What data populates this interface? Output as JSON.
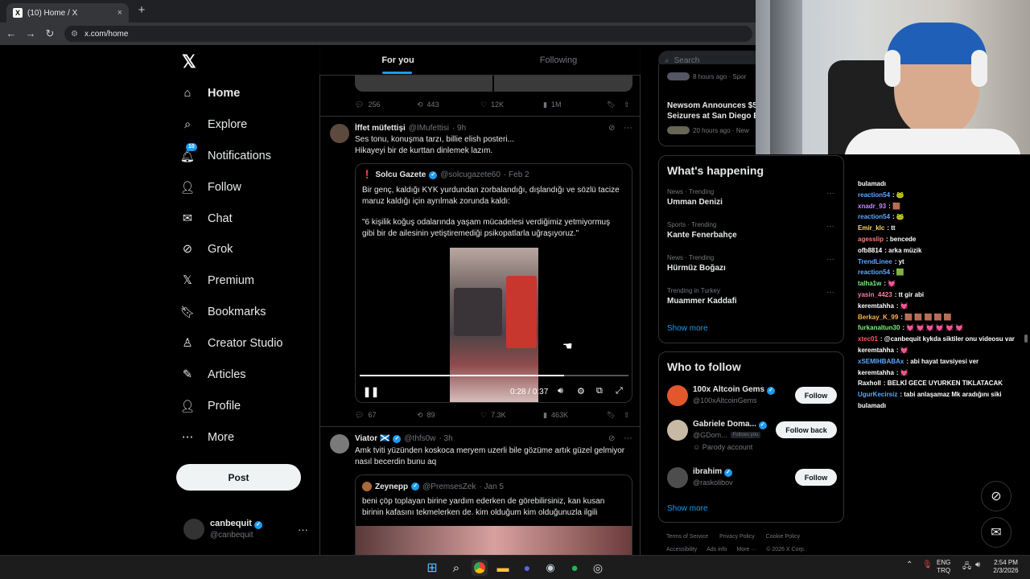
{
  "browser": {
    "tab_title": "(10) Home / X",
    "tab_close": "×",
    "new_tab": "+",
    "url": "x.com/home"
  },
  "nav": {
    "items": [
      {
        "label": "Home",
        "icon": "home-icon"
      },
      {
        "label": "Explore",
        "icon": "search-icon"
      },
      {
        "label": "Notifications",
        "icon": "bell-icon",
        "badge": "10"
      },
      {
        "label": "Follow",
        "icon": "person-plus-icon"
      },
      {
        "label": "Chat",
        "icon": "envelope-icon"
      },
      {
        "label": "Grok",
        "icon": "grok-icon"
      },
      {
        "label": "Premium",
        "icon": "x-icon"
      },
      {
        "label": "Bookmarks",
        "icon": "bookmark-icon"
      },
      {
        "label": "Creator Studio",
        "icon": "creator-icon"
      },
      {
        "label": "Articles",
        "icon": "article-icon"
      },
      {
        "label": "Profile",
        "icon": "person-icon"
      },
      {
        "label": "More",
        "icon": "more-circle-icon"
      }
    ],
    "post_label": "Post",
    "account": {
      "name": "canbequit",
      "handle": "@canbequit"
    }
  },
  "timeline": {
    "tabs": [
      "For you",
      "Following"
    ],
    "prev_tweet_stats": {
      "replies": "256",
      "reposts": "443",
      "likes": "12K",
      "views": "1M"
    },
    "tweet1": {
      "name": "İffet müfettişi",
      "handle": "@IMufettisi",
      "time": "· 9h",
      "text1": "Ses tonu, konuşma tarzı, billie elish posteri...",
      "text2": "Hikayeyi bir de kurttan dinlemek lazım.",
      "quote": {
        "name": "Solcu Gazete",
        "handle": "@solcugazete60",
        "time": "· Feb 2",
        "text1": "Bir genç, kaldığı KYK yurdundan zorbalandığı, dışlandığı ve sözlü tacize",
        "text2": "maruz kaldığı için ayrılmak zorunda kaldı:",
        "text3": "\"6 kişilik koğuş odalarında yaşam mücadelesi verdiğimiz yetmiyormuş",
        "text4": "gibi bir de ailesinin yetiştiremediği psikopatlarla uğraşıyoruz.\""
      },
      "video": {
        "time": "0:28 / 0:37",
        "progress": 0.76
      },
      "stats": {
        "replies": "67",
        "reposts": "89",
        "likes": "7.3K",
        "views": "463K"
      }
    },
    "tweet2": {
      "name": "Viator 🏴󠁧󠁢󠁳󠁣󠁴󠁿",
      "handle": "@thfs0w",
      "time": "· 3h",
      "text1": "Amk tviti yüzünden koskoca meryem uzerli bile gözüme artık güzel gelmiyor",
      "text2": "nasıl becerdin bunu aq",
      "quote": {
        "name": "Zeynepp",
        "handle": "@PremsesZek",
        "time": "· Jan 5",
        "text1": "beni çöp toplayan birine yardım ederken de görebilirsiniz, kan kusan",
        "text2": "birinin kafasını tekmelerken de. kim olduğum kim olduğunuzla ilgili"
      }
    }
  },
  "right": {
    "search_placeholder": "Search",
    "news": [
      {
        "meta": "8 hours ago · Spor"
      },
      {
        "title1": "Newsom Announces $5",
        "title2": "Seizures at San Diego B",
        "meta": "20 hours ago · New"
      }
    ],
    "happening_title": "What's happening",
    "trends": [
      {
        "cat": "News · Trending",
        "name": "Umman Denizi"
      },
      {
        "cat": "Sports · Trending",
        "name": "Kante Fenerbahçe"
      },
      {
        "cat": "News · Trending",
        "name": "Hürmüz Boğazı"
      },
      {
        "cat": "Trending in Turkey",
        "name": "Muammer Kaddafi"
      }
    ],
    "show_more": "Show more",
    "who_title": "Who to follow",
    "who": [
      {
        "name": "100x Altcoin Gems",
        "handle": "@100xAltcoinGems",
        "btn": "Follow"
      },
      {
        "name": "Gabriele Doma...",
        "handle": "@GDom...",
        "extra": "Follows you",
        "sub": "Parody account",
        "btn": "Follow back"
      },
      {
        "name": "ibrahim",
        "handle": "@raskolibov",
        "btn": "Follow"
      }
    ],
    "footer1": [
      "Terms of Service",
      "Privacy Policy",
      "Cookie Policy"
    ],
    "footer2": [
      "Accessibility",
      "Ads info",
      "More ···",
      "© 2026 X Corp."
    ]
  },
  "chat": [
    {
      "user": "bulamadı",
      "msg": "",
      "color": "#ffffff"
    },
    {
      "user": "reaction54",
      "msg": ": 🐸",
      "color": "#5aa9ff"
    },
    {
      "user": "xnadr_93",
      "msg": ": 🟫",
      "color": "#c58bff"
    },
    {
      "user": "reaction54",
      "msg": ": 🐸",
      "color": "#5aa9ff"
    },
    {
      "user": "Emir_klc",
      "msg": ": tt",
      "color": "#ffd76a"
    },
    {
      "user": "agesslip",
      "msg": ": bencede",
      "color": "#ff7a7a"
    },
    {
      "user": "ofb8814",
      "msg": ": arka müzik",
      "color": "#ffffff"
    },
    {
      "user": "TrendLinee",
      "msg": ": yt",
      "color": "#5aa9ff"
    },
    {
      "user": "reaction54",
      "msg": ": 🟩",
      "color": "#5aa9ff"
    },
    {
      "user": "talha1w",
      "msg": ": 💓",
      "color": "#7cf07c"
    },
    {
      "user": "yasin_4423",
      "msg": ": tt gir abi",
      "color": "#ff7aa8"
    },
    {
      "user": "keremtahha",
      "msg": ": 💓",
      "color": "#ffffff"
    },
    {
      "user": "Berkay_K_99",
      "msg": ": 🟫 🟫 🟫 🟫 🟫",
      "color": "#ffb347"
    },
    {
      "user": "furkanaltun30",
      "msg": ": 💓 💓 💓 💓 💓 💓",
      "color": "#7cf07c"
    },
    {
      "user": "xtec01",
      "msg": ": @canbequit kykda siktiler onu videosu var",
      "color": "#ff5a5a"
    },
    {
      "user": "keremtahha",
      "msg": ": 💓",
      "color": "#ffffff"
    },
    {
      "user": "xSEMIHBABAx",
      "msg": ": abi hayat tavsiyesi ver",
      "color": "#5aa9ff"
    },
    {
      "user": "keremtahha",
      "msg": ": 💓",
      "color": "#ffffff"
    },
    {
      "user": "Raxholl",
      "msg": ": BELKİ GECE UYURKEN TIKLATACAK",
      "color": "#ffffff"
    },
    {
      "user": "UgurKecirsiz",
      "msg": ": tabi anlaşamaz Mk aradığını siki",
      "color": "#5aa9ff"
    },
    {
      "user": "bulamadı",
      "msg": "",
      "color": "#ffffff"
    }
  ],
  "tray": {
    "lang1": "ENG",
    "lang2": "TRQ",
    "time": "2:54 PM",
    "date": "2/3/2026"
  },
  "colors": {
    "accent": "#1d9bf0",
    "bg": "#000000",
    "border": "#2f3336"
  }
}
